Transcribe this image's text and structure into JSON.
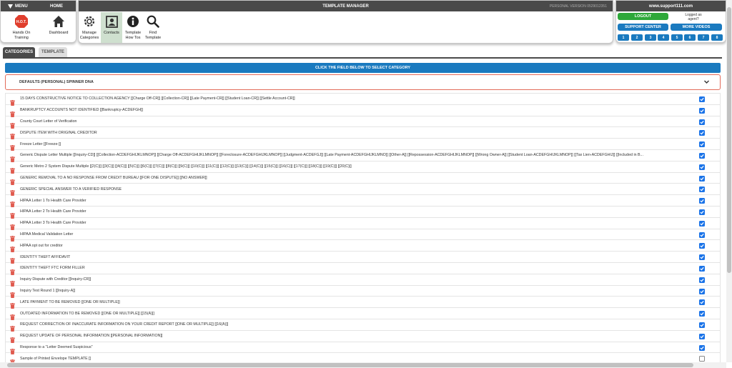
{
  "menu": {
    "menu_label": "MENU",
    "home_label": "HOME",
    "items": [
      {
        "label": "Hands On Training",
        "icon": "hot-badge-icon"
      },
      {
        "label": "Dashboard",
        "icon": "home-icon"
      }
    ]
  },
  "template_manager": {
    "title": "TEMPLATE MANAGER",
    "version": "PERSONAL VERSION 0529012351",
    "tools": [
      {
        "label": "Manage Categories",
        "icon": "gear-icon"
      },
      {
        "label": "Contacts",
        "icon": "contact-card-icon"
      },
      {
        "label": "Template How Tos",
        "icon": "info-icon"
      },
      {
        "label": "Find Template",
        "icon": "search-icon"
      }
    ]
  },
  "support": {
    "site": "www.support111.com",
    "logout_label": "LOGOUT",
    "logged_as": "Logged as",
    "user": "agent?",
    "support_center_label": "SUPPORT CENTER",
    "more_videos_label": "MORE VIDEOS",
    "pages": [
      "1",
      "2",
      "3",
      "4",
      "5",
      "6",
      "7",
      "8"
    ]
  },
  "tabs": {
    "categories": "CATEGORIES",
    "template": "TEMPLATE"
  },
  "banner": "CLICK THE FIELD BELOW TO SELECT CATEGORY",
  "category_select": {
    "value": "DEFAULTS (PERSONAL) SPINNER DNA"
  },
  "templates": [
    {
      "label": "15 DAYS CONSTRUCTIVE NOTICE TO COLLECTION AGENCY [[Charge Off-CR]] [[Collection-CR]] [[Late Payment-CR]] [[Student Loan-CR]] [[Settle Account-CR]]",
      "checked": true
    },
    {
      "label": "BANKRUPTCY ACCOUNTS NOT IDENTIFIED [[Bankruptcy-ACDEFGH]]",
      "checked": true
    },
    {
      "label": "County Court Letter of Verification",
      "checked": true
    },
    {
      "label": "DISPUTE ITEM WITH ORIGINAL CREDITOR",
      "checked": true
    },
    {
      "label": "Freeze Letter [[Freeze-]]",
      "checked": true
    },
    {
      "label": "Generic Dispute Letter Multiple [[Inquiry-CD]] [[Collection-ACDEFGHIJKLMNOP]] [[Charge Off-ACDEFGHIJKLMNOP]] [[Foreclosure-ACDEFGHIJKLMNOP]] [[Judgment-ACDEFGJ]] [[Late Payment-ACDEFGHIJKLMNO]] [[Other-A]] [[Repossession-ACDEFGHIJKLMNOP]] [[Wrong Owner-A]] [[Student Loan-ACDEFGHIJKLMNOP]] [[Tax Lien-ACDEFGHIJ]] [[Included in B...",
      "checked": true
    },
    {
      "label": "Generic Metro 2 System Dispute Multiple [[2(C)]] [[3(C)]] [[4(C)]] [[5(C)]] [[6(C)]] [[7(C)]] [[8(C)]] [[9(C)]] [[10(C)]] [[11(C)]] [[12(C)]] [[13(C)]] [[14(C)]] [[15(C)]] [[16(C)]] [[17(C)]] [[18(C)]] [[19(C)]] [[20(C)]]",
      "checked": true
    },
    {
      "label": "GENERIC REMOVAL TO A NO RESPONSE FROM CREDIT BUREAU [[FOR ONE DISPUTE]] [[NO ANSWER]]",
      "checked": true
    },
    {
      "label": "GENERIC SPECIAL ANSWER TO A VERIFIED RESPONSE",
      "checked": true
    },
    {
      "label": "HIPAA Letter 1 To Health Care Provider",
      "checked": true
    },
    {
      "label": "HIPAA Letter 2 To Health Care Provider",
      "checked": true
    },
    {
      "label": "HIPAA Letter 3 To Health Care Provider",
      "checked": true
    },
    {
      "label": "HIPAA Medical Validation Letter",
      "checked": true
    },
    {
      "label": "HIPAA opt out for creditor",
      "checked": true
    },
    {
      "label": "IDENTITY THEFT AFFIDAVIT",
      "checked": true
    },
    {
      "label": "IDENTITY THEFT FTC FORM FILLER",
      "checked": true
    },
    {
      "label": "Inquiry Dispute with Creditor [[Inquiry-CR]]",
      "checked": true
    },
    {
      "label": "Inquiry Test Round 1 [[Inquiry-A]]",
      "checked": true
    },
    {
      "label": "LATE PAYMENT TO BE REMOVED [[ONE OR MULTIPLE]]",
      "checked": true
    },
    {
      "label": "OUTDATED INFORMATION TO BE REMOVED [[ONE OR MULTIPLE]] [[15(A)]]",
      "checked": true
    },
    {
      "label": "REQUEST CORRECTION OF INACCURATE INFORMATION ON YOUR CREDIT REPORT [[ONE OR MULTIPLE]] [[16(A)]]",
      "checked": true
    },
    {
      "label": "REQUEST UPDATE OF PERSONAL INFORMATION [[PERSONAL INFORMATION]]",
      "checked": true
    },
    {
      "label": "Response to a \"Letter Deemed Suspicious\"",
      "checked": true
    },
    {
      "label": "Sample of Printed Envelope TEMPLATE []",
      "checked": false
    }
  ]
}
